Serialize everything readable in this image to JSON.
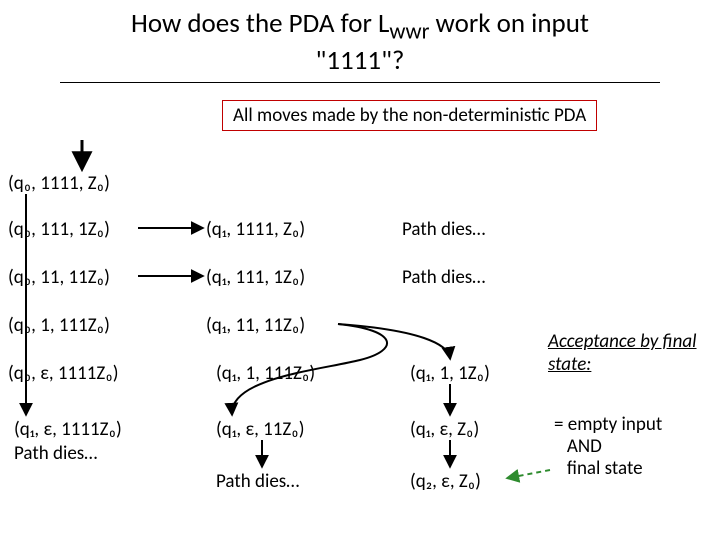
{
  "title_line1": "How does the PDA for L",
  "title_sub": "wwr",
  "title_line1b": " work on input",
  "title_line2": "\"1111\"?",
  "subtitle": "All moves made by the non-deterministic PDA",
  "nodes": {
    "a0": "(q₀, 1111, Z₀)",
    "a1": "(q₀, 111, 1Z₀)",
    "a2": "(q₀, 11, 11Z₀)",
    "a3": "(q₀, 1, 111Z₀)",
    "a4": "(q₀, ε, 1111Z₀)",
    "a5a": "(q₁, ε, 1111Z₀)",
    "a5b": "Path dies…",
    "b1": "(q₁, 1111, Z₀)",
    "b2": "(q₁, 111, 1Z₀)",
    "b3": "(q₁, 11, 11Z₀)",
    "b4": "(q₁, 1, 111Z₀)",
    "b5": "(q₁, ε, 11Z₀)",
    "b6": "Path dies…",
    "c1": "Path dies…",
    "c2": "Path dies…",
    "c4": "(q₁, 1, 1Z₀)",
    "c5": "(q₁, ε, Z₀)",
    "c6": "(q₂, ε, Z₀)"
  },
  "accept_label": "Acceptance by final state:",
  "note_line1": "= empty input",
  "note_line2": "AND",
  "note_line3": "final state"
}
